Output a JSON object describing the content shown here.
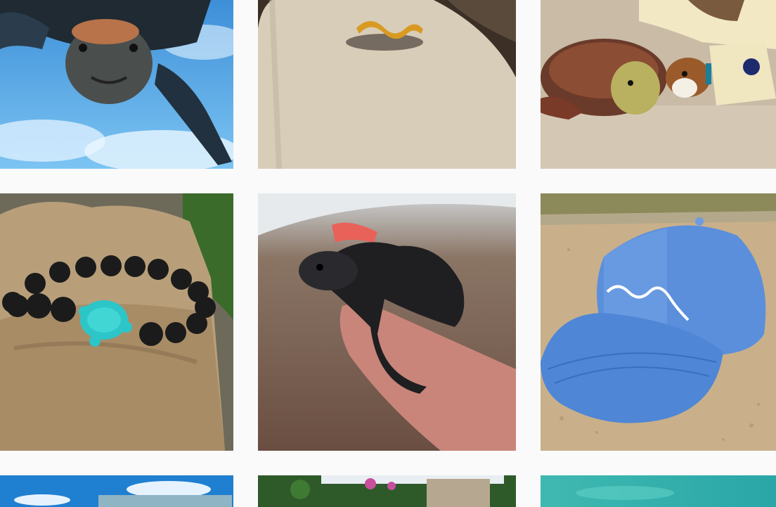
{
  "grid": {
    "posts": [
      {
        "subject": "sea-turtle-swimming-underwater"
      },
      {
        "subject": "gold-wave-ring-on-driftwood"
      },
      {
        "subject": "dog-and-sea-turtle-on-beach"
      },
      {
        "subject": "lava-bead-turtle-bracelet"
      },
      {
        "subject": "baby-turtle-on-hand"
      },
      {
        "subject": "blue-wave-embroidered-cap"
      },
      {
        "subject": "beach-scene-partial"
      },
      {
        "subject": "garden-house-partial"
      },
      {
        "subject": "turquoise-water-partial"
      }
    ]
  },
  "colors": {
    "background": "#fafafa",
    "ocean_blue": "#4aa3df",
    "cap_blue": "#4f86d6",
    "turquoise": "#2cc5c8",
    "sand": "#c9b08a"
  }
}
